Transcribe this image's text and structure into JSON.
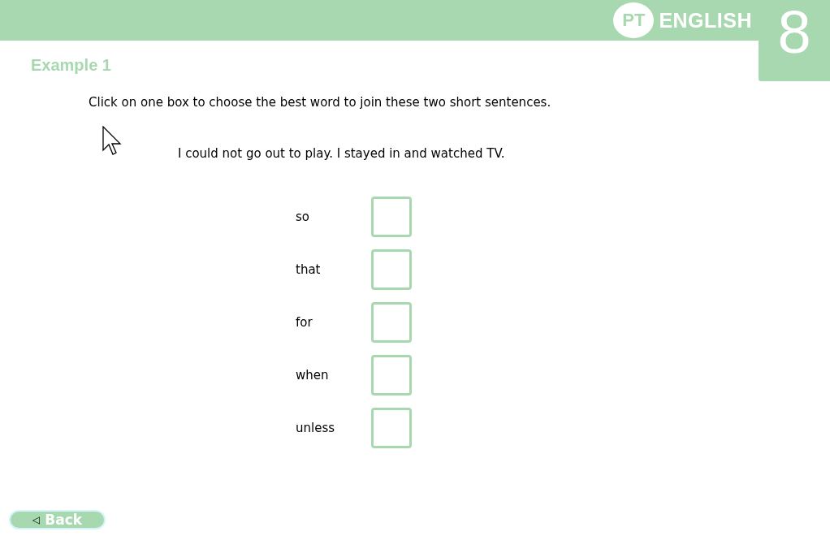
{
  "header": {
    "logo_badge": "PT",
    "logo_text": "ENGLISH",
    "grade": "8"
  },
  "title": "Example 1",
  "instruction": "Click on one box to choose the best word to join these two short sentences.",
  "sentences": "I could not go out to play. I stayed in and watched TV.",
  "options": [
    {
      "label": "so",
      "selected": false
    },
    {
      "label": "that",
      "selected": false
    },
    {
      "label": "for",
      "selected": false
    },
    {
      "label": "when",
      "selected": false
    },
    {
      "label": "unless",
      "selected": false
    }
  ],
  "back_button": {
    "icon": "◁",
    "label": "Back"
  }
}
